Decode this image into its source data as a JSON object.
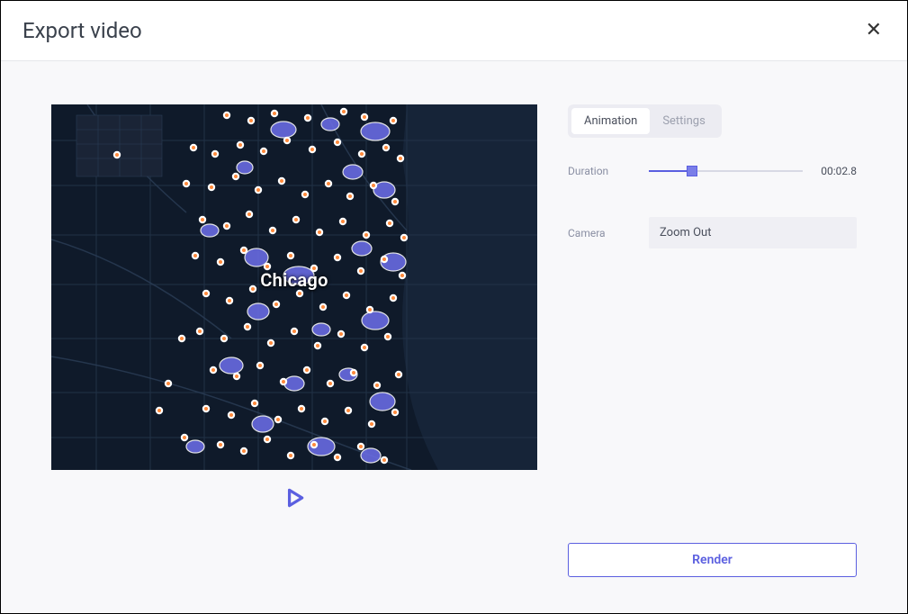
{
  "header": {
    "title": "Export video"
  },
  "preview": {
    "city_label": "Chicago"
  },
  "tabs": {
    "animation": "Animation",
    "settings": "Settings",
    "active": "animation"
  },
  "controls": {
    "duration": {
      "label": "Duration",
      "value_display": "00:02.8",
      "slider_percent": 28
    },
    "camera": {
      "label": "Camera",
      "value": "Zoom Out"
    }
  },
  "actions": {
    "render": "Render"
  }
}
